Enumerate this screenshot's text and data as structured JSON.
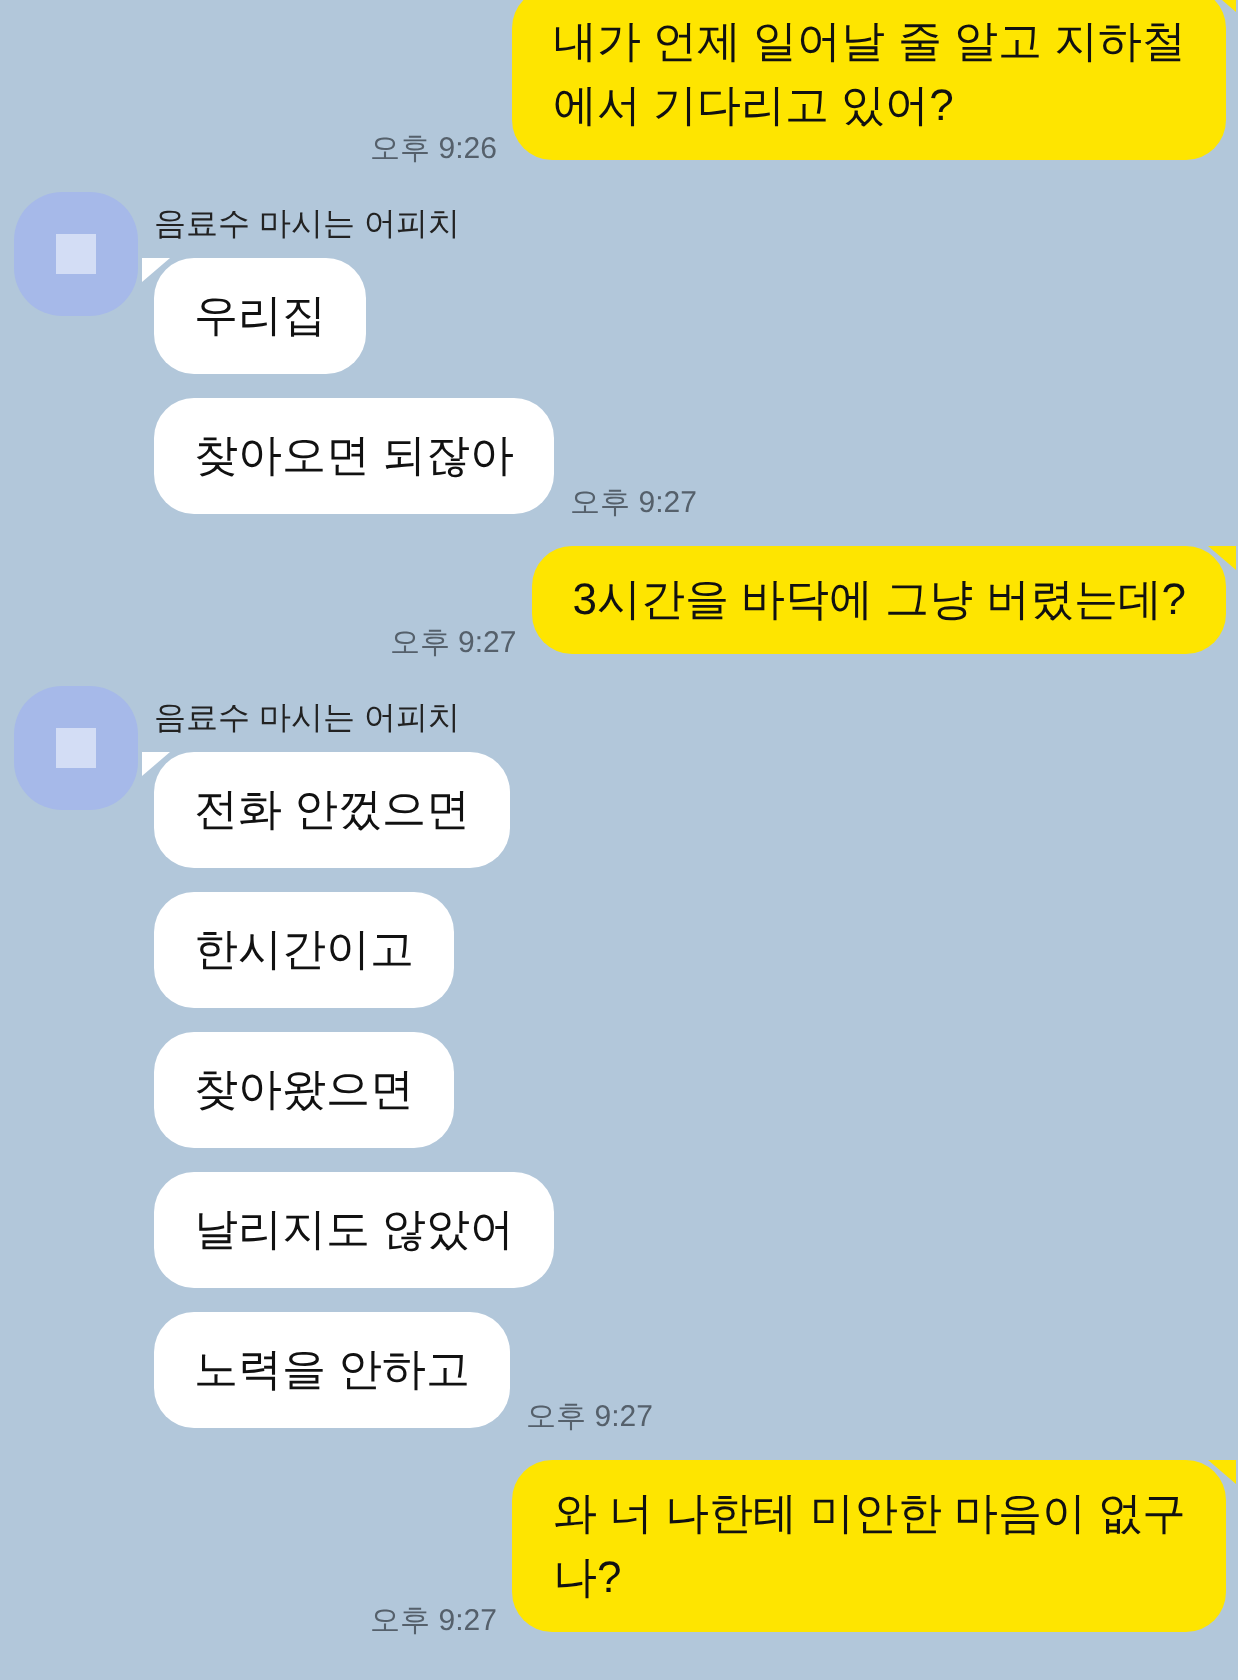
{
  "messages": [
    {
      "kind": "sent",
      "text": "내가 언제 일어날 줄 알고 지하철\n에서 기다리고 있어?",
      "time": "오후 9:26"
    },
    {
      "kind": "received",
      "sender": "음료수 마시는 어피치",
      "bubbles": [
        "우리집",
        "찾아오면 되잖아"
      ],
      "time": "오후 9:27"
    },
    {
      "kind": "sent",
      "text": "3시간을 바닥에 그냥 버렸는데?",
      "time": "오후 9:27"
    },
    {
      "kind": "received",
      "sender": "음료수 마시는 어피치",
      "bubbles": [
        "전화 안껐으면",
        "한시간이고",
        "찾아왔으면",
        "날리지도 않았어",
        "노력을 안하고"
      ],
      "time": "오후 9:27"
    },
    {
      "kind": "sent",
      "text": "와 너 나한테 미안한 마음이 없구\n나?",
      "time": "오후 9:27"
    }
  ]
}
